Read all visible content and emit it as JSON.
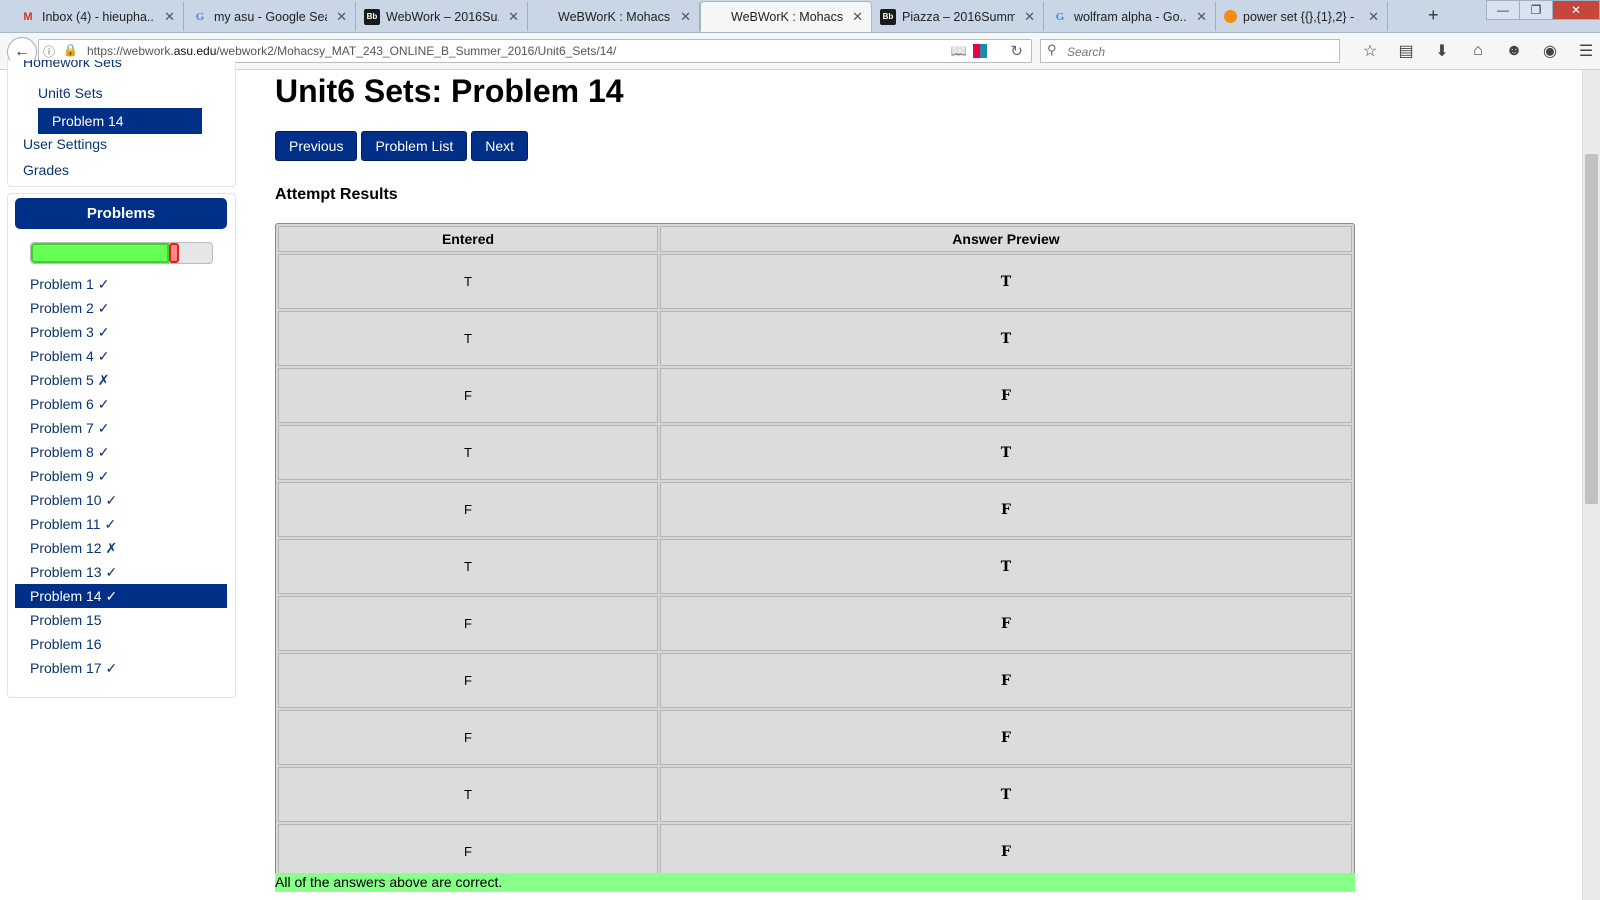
{
  "browser": {
    "tabs": [
      {
        "label": "Inbox (4) - hieupha...",
        "icon": "gmail-icon"
      },
      {
        "label": "my asu - Google Sea...",
        "icon": "google-icon"
      },
      {
        "label": "WebWork – 2016Su...",
        "icon": "blackboard-icon"
      },
      {
        "label": "WeBWorK : Mohacs...",
        "icon": ""
      },
      {
        "label": "WeBWorK : Mohacs...",
        "icon": "",
        "active": true
      },
      {
        "label": "Piazza – 2016Summ...",
        "icon": "blackboard-icon"
      },
      {
        "label": "wolfram alpha - Go...",
        "icon": "google-icon"
      },
      {
        "label": "power set {{},{1},2} - ...",
        "icon": "stackoverflow-icon"
      }
    ],
    "url_prefix": "https://webwork.",
    "url_domain": "asu.edu",
    "url_path": "/webwork2/Mohacsy_MAT_243_ONLINE_B_Summer_2016/Unit6_Sets/14/",
    "search_placeholder": "Search"
  },
  "sidebar": {
    "homework_sets_label": "Homework Sets",
    "set_label": "Unit6 Sets",
    "current_problem_label": "Problem 14",
    "user_settings_label": "User Settings",
    "grades_label": "Grades",
    "problems_header": "Problems",
    "progress": {
      "correct_fraction": 0.76,
      "incorrect_fraction": 0.06
    },
    "problems": [
      "Problem 1 ✓",
      "Problem 2 ✓",
      "Problem 3 ✓",
      "Problem 4 ✓",
      "Problem 5 ✗",
      "Problem 6 ✓",
      "Problem 7 ✓",
      "Problem 8 ✓",
      "Problem 9 ✓",
      "Problem 10 ✓",
      "Problem 11 ✓",
      "Problem 12 ✗",
      "Problem 13 ✓",
      "Problem 14 ✓",
      "Problem 15",
      "Problem 16",
      "Problem 17 ✓"
    ],
    "current_index": 13
  },
  "main": {
    "title": "Unit6 Sets: Problem 14",
    "buttons": {
      "previous": "Previous",
      "problem_list": "Problem List",
      "next": "Next"
    },
    "results_heading": "Attempt Results",
    "table": {
      "headers": [
        "Entered",
        "Answer Preview"
      ],
      "rows": [
        [
          "T",
          "T"
        ],
        [
          "T",
          "T"
        ],
        [
          "F",
          "F"
        ],
        [
          "T",
          "T"
        ],
        [
          "F",
          "F"
        ],
        [
          "T",
          "T"
        ],
        [
          "F",
          "F"
        ],
        [
          "F",
          "F"
        ],
        [
          "F",
          "F"
        ],
        [
          "T",
          "T"
        ],
        [
          "F",
          "F"
        ]
      ]
    },
    "summary": "All of the answers above are correct."
  }
}
